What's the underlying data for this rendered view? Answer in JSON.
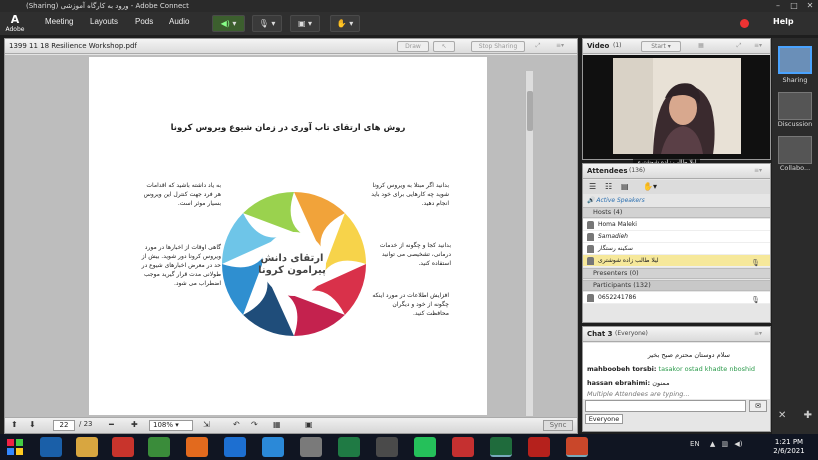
{
  "window": {
    "title": "(Sharing) ورود به کارگاه آموزشی - Adobe Connect"
  },
  "menu": {
    "logo_small": "Adobe",
    "items": [
      "Meeting",
      "Layouts",
      "Pods",
      "Audio"
    ],
    "help": "Help"
  },
  "share_pod": {
    "title": "1399 11 18 Resilience Workshop.pdf",
    "draw": "Draw",
    "stop_sharing": "Stop Sharing",
    "page_current": "22",
    "page_total": "/ 23",
    "zoom": "108%",
    "sync": "Sync"
  },
  "slide": {
    "title": "روش های ارتقای تاب آوری در زمان شیوع ویروس کرونا",
    "center": "ارتقای دانش پیرامون کرونا",
    "left_1": "به یاد داشته باشید که اقدامات هر فرد جهت کنترل این ویروس بسیار موثر است.",
    "left_2": "گاهی اوقات از اخبارها در مورد ویروس کرونا دور شوید. بیش از حد در معرض اخبارهای شیوع در طولانی مدت قرار گیرید موجب اضطراب می شود.",
    "right_1": "بدانید اگر مبتلا به ویروس کرونا شوید چه کارهایی برای خود باید انجام دهید.",
    "right_2": "بدانید کجا و چگونه از خدمات درمانی، تشخیصی می توانید استفاده کنید.",
    "right_3": "افزایش اطلاعات در مورد اینکه چگونه از خود و دیگران محافظت کنید.",
    "colors": [
      "#f1a33a",
      "#f7d34a",
      "#d9314a",
      "#c4224e",
      "#1f4d7a",
      "#2f8fd0",
      "#6ec5e8",
      "#9ad24e"
    ]
  },
  "video_pod": {
    "title": "Video",
    "count": "(1)",
    "start": "Start",
    "name_label": "لیلا طالب زاده شوشتری"
  },
  "attendees": {
    "title": "Attendees",
    "count": "(136)",
    "active_speakers": "Active Speakers",
    "hosts_label": "Hosts (4)",
    "hosts": [
      "Homa Maleki",
      "Samadieh",
      "سکینه رستگار",
      "لیلا طالب زاده شوشتری"
    ],
    "presenters_label": "Presenters (0)",
    "participants_label": "Participants (132)",
    "participants": [
      "0652241786"
    ]
  },
  "chat": {
    "title": "Chat 3",
    "scope": "(Everyone)",
    "messages": [
      {
        "name": "",
        "text": "سلام دوستان محترم صبح بخیر"
      },
      {
        "name": "mahboobeh torsbi:",
        "text": "tasakor ostad khadte nboshid"
      },
      {
        "name": "hassan ebrahimi:",
        "text": "ممنون"
      }
    ],
    "typing": "Multiple Attendees are typing...",
    "tab": "Everyone"
  },
  "layouts": {
    "items": [
      "Sharing",
      "Discussion",
      "Collabo..."
    ]
  },
  "taskbar": {
    "lang": "EN",
    "time": "1:21 PM",
    "date": "2/6/2021"
  }
}
